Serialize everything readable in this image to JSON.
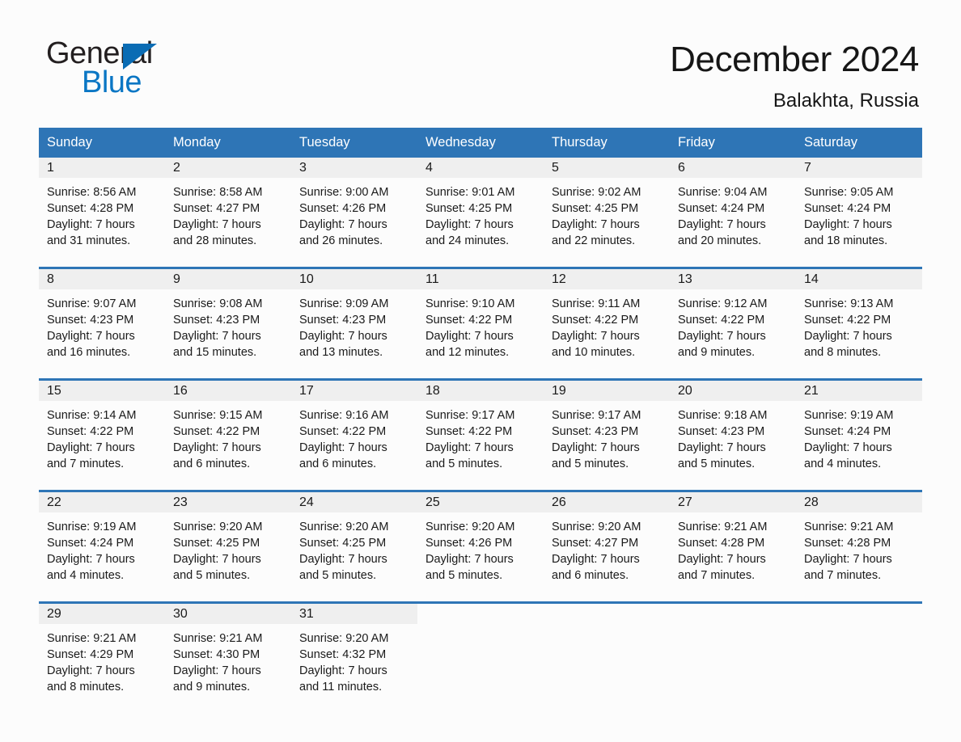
{
  "brand": {
    "name_part1": "General",
    "name_part2": "Blue",
    "triangle_color": "#0a6cb4",
    "blue_color": "#0a76c4"
  },
  "header": {
    "title": "December 2024",
    "subtitle": "Balakhta, Russia"
  },
  "theme": {
    "header_blue": "#2e75b6",
    "day_band_gray": "#efefef",
    "page_background": "#fcfcfc"
  },
  "calendar": {
    "weekdays": [
      "Sunday",
      "Monday",
      "Tuesday",
      "Wednesday",
      "Thursday",
      "Friday",
      "Saturday"
    ],
    "weeks": [
      [
        {
          "day": "1",
          "sunrise": "Sunrise: 8:56 AM",
          "sunset": "Sunset: 4:28 PM",
          "daylight_line1": "Daylight: 7 hours",
          "daylight_line2": "and 31 minutes."
        },
        {
          "day": "2",
          "sunrise": "Sunrise: 8:58 AM",
          "sunset": "Sunset: 4:27 PM",
          "daylight_line1": "Daylight: 7 hours",
          "daylight_line2": "and 28 minutes."
        },
        {
          "day": "3",
          "sunrise": "Sunrise: 9:00 AM",
          "sunset": "Sunset: 4:26 PM",
          "daylight_line1": "Daylight: 7 hours",
          "daylight_line2": "and 26 minutes."
        },
        {
          "day": "4",
          "sunrise": "Sunrise: 9:01 AM",
          "sunset": "Sunset: 4:25 PM",
          "daylight_line1": "Daylight: 7 hours",
          "daylight_line2": "and 24 minutes."
        },
        {
          "day": "5",
          "sunrise": "Sunrise: 9:02 AM",
          "sunset": "Sunset: 4:25 PM",
          "daylight_line1": "Daylight: 7 hours",
          "daylight_line2": "and 22 minutes."
        },
        {
          "day": "6",
          "sunrise": "Sunrise: 9:04 AM",
          "sunset": "Sunset: 4:24 PM",
          "daylight_line1": "Daylight: 7 hours",
          "daylight_line2": "and 20 minutes."
        },
        {
          "day": "7",
          "sunrise": "Sunrise: 9:05 AM",
          "sunset": "Sunset: 4:24 PM",
          "daylight_line1": "Daylight: 7 hours",
          "daylight_line2": "and 18 minutes."
        }
      ],
      [
        {
          "day": "8",
          "sunrise": "Sunrise: 9:07 AM",
          "sunset": "Sunset: 4:23 PM",
          "daylight_line1": "Daylight: 7 hours",
          "daylight_line2": "and 16 minutes."
        },
        {
          "day": "9",
          "sunrise": "Sunrise: 9:08 AM",
          "sunset": "Sunset: 4:23 PM",
          "daylight_line1": "Daylight: 7 hours",
          "daylight_line2": "and 15 minutes."
        },
        {
          "day": "10",
          "sunrise": "Sunrise: 9:09 AM",
          "sunset": "Sunset: 4:23 PM",
          "daylight_line1": "Daylight: 7 hours",
          "daylight_line2": "and 13 minutes."
        },
        {
          "day": "11",
          "sunrise": "Sunrise: 9:10 AM",
          "sunset": "Sunset: 4:22 PM",
          "daylight_line1": "Daylight: 7 hours",
          "daylight_line2": "and 12 minutes."
        },
        {
          "day": "12",
          "sunrise": "Sunrise: 9:11 AM",
          "sunset": "Sunset: 4:22 PM",
          "daylight_line1": "Daylight: 7 hours",
          "daylight_line2": "and 10 minutes."
        },
        {
          "day": "13",
          "sunrise": "Sunrise: 9:12 AM",
          "sunset": "Sunset: 4:22 PM",
          "daylight_line1": "Daylight: 7 hours",
          "daylight_line2": "and 9 minutes."
        },
        {
          "day": "14",
          "sunrise": "Sunrise: 9:13 AM",
          "sunset": "Sunset: 4:22 PM",
          "daylight_line1": "Daylight: 7 hours",
          "daylight_line2": "and 8 minutes."
        }
      ],
      [
        {
          "day": "15",
          "sunrise": "Sunrise: 9:14 AM",
          "sunset": "Sunset: 4:22 PM",
          "daylight_line1": "Daylight: 7 hours",
          "daylight_line2": "and 7 minutes."
        },
        {
          "day": "16",
          "sunrise": "Sunrise: 9:15 AM",
          "sunset": "Sunset: 4:22 PM",
          "daylight_line1": "Daylight: 7 hours",
          "daylight_line2": "and 6 minutes."
        },
        {
          "day": "17",
          "sunrise": "Sunrise: 9:16 AM",
          "sunset": "Sunset: 4:22 PM",
          "daylight_line1": "Daylight: 7 hours",
          "daylight_line2": "and 6 minutes."
        },
        {
          "day": "18",
          "sunrise": "Sunrise: 9:17 AM",
          "sunset": "Sunset: 4:22 PM",
          "daylight_line1": "Daylight: 7 hours",
          "daylight_line2": "and 5 minutes."
        },
        {
          "day": "19",
          "sunrise": "Sunrise: 9:17 AM",
          "sunset": "Sunset: 4:23 PM",
          "daylight_line1": "Daylight: 7 hours",
          "daylight_line2": "and 5 minutes."
        },
        {
          "day": "20",
          "sunrise": "Sunrise: 9:18 AM",
          "sunset": "Sunset: 4:23 PM",
          "daylight_line1": "Daylight: 7 hours",
          "daylight_line2": "and 5 minutes."
        },
        {
          "day": "21",
          "sunrise": "Sunrise: 9:19 AM",
          "sunset": "Sunset: 4:24 PM",
          "daylight_line1": "Daylight: 7 hours",
          "daylight_line2": "and 4 minutes."
        }
      ],
      [
        {
          "day": "22",
          "sunrise": "Sunrise: 9:19 AM",
          "sunset": "Sunset: 4:24 PM",
          "daylight_line1": "Daylight: 7 hours",
          "daylight_line2": "and 4 minutes."
        },
        {
          "day": "23",
          "sunrise": "Sunrise: 9:20 AM",
          "sunset": "Sunset: 4:25 PM",
          "daylight_line1": "Daylight: 7 hours",
          "daylight_line2": "and 5 minutes."
        },
        {
          "day": "24",
          "sunrise": "Sunrise: 9:20 AM",
          "sunset": "Sunset: 4:25 PM",
          "daylight_line1": "Daylight: 7 hours",
          "daylight_line2": "and 5 minutes."
        },
        {
          "day": "25",
          "sunrise": "Sunrise: 9:20 AM",
          "sunset": "Sunset: 4:26 PM",
          "daylight_line1": "Daylight: 7 hours",
          "daylight_line2": "and 5 minutes."
        },
        {
          "day": "26",
          "sunrise": "Sunrise: 9:20 AM",
          "sunset": "Sunset: 4:27 PM",
          "daylight_line1": "Daylight: 7 hours",
          "daylight_line2": "and 6 minutes."
        },
        {
          "day": "27",
          "sunrise": "Sunrise: 9:21 AM",
          "sunset": "Sunset: 4:28 PM",
          "daylight_line1": "Daylight: 7 hours",
          "daylight_line2": "and 7 minutes."
        },
        {
          "day": "28",
          "sunrise": "Sunrise: 9:21 AM",
          "sunset": "Sunset: 4:28 PM",
          "daylight_line1": "Daylight: 7 hours",
          "daylight_line2": "and 7 minutes."
        }
      ],
      [
        {
          "day": "29",
          "sunrise": "Sunrise: 9:21 AM",
          "sunset": "Sunset: 4:29 PM",
          "daylight_line1": "Daylight: 7 hours",
          "daylight_line2": "and 8 minutes."
        },
        {
          "day": "30",
          "sunrise": "Sunrise: 9:21 AM",
          "sunset": "Sunset: 4:30 PM",
          "daylight_line1": "Daylight: 7 hours",
          "daylight_line2": "and 9 minutes."
        },
        {
          "day": "31",
          "sunrise": "Sunrise: 9:20 AM",
          "sunset": "Sunset: 4:32 PM",
          "daylight_line1": "Daylight: 7 hours",
          "daylight_line2": "and 11 minutes."
        },
        {
          "day": "",
          "sunrise": "",
          "sunset": "",
          "daylight_line1": "",
          "daylight_line2": ""
        },
        {
          "day": "",
          "sunrise": "",
          "sunset": "",
          "daylight_line1": "",
          "daylight_line2": ""
        },
        {
          "day": "",
          "sunrise": "",
          "sunset": "",
          "daylight_line1": "",
          "daylight_line2": ""
        },
        {
          "day": "",
          "sunrise": "",
          "sunset": "",
          "daylight_line1": "",
          "daylight_line2": ""
        }
      ]
    ]
  }
}
